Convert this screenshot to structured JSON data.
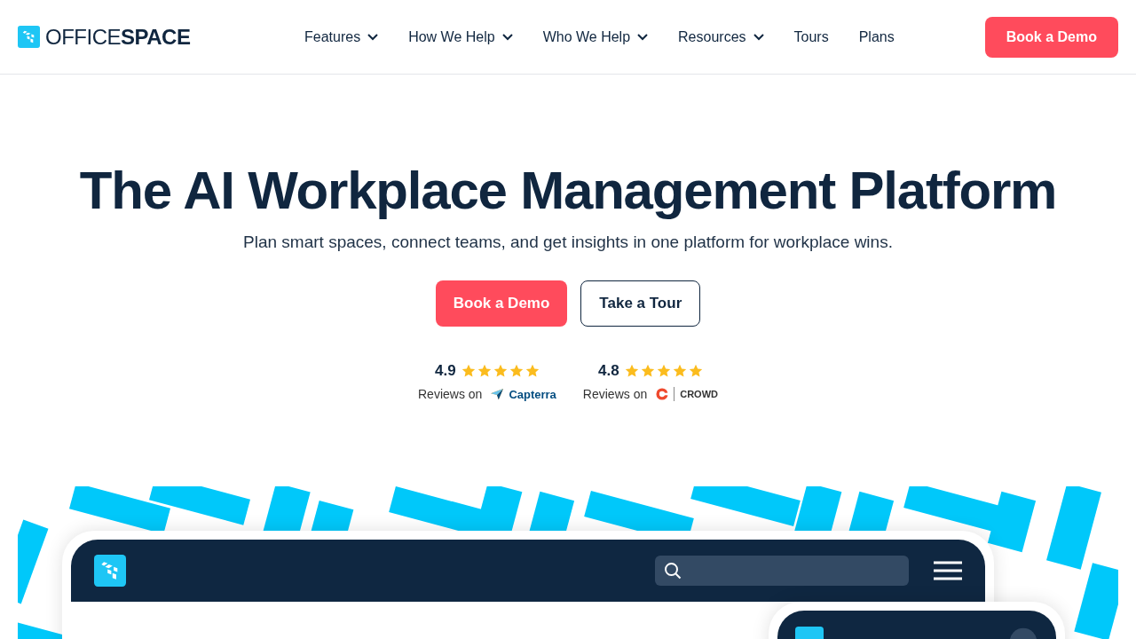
{
  "header": {
    "logo": "OFFICE**SPACE**",
    "nav": [
      {
        "label": "Features",
        "dropdown": true
      },
      {
        "label": "How We Help",
        "dropdown": true
      },
      {
        "label": "Who We Help",
        "dropdown": true
      },
      {
        "label": "Resources",
        "dropdown": true
      },
      {
        "label": "Tours",
        "dropdown": false
      },
      {
        "label": "Plans",
        "dropdown": false
      }
    ],
    "cta": "Book a Demo"
  },
  "hero": {
    "title": "The AI Workplace Management Platform",
    "subtitle": "Plan smart spaces, connect teams, and get insights in one platform for workplace wins.",
    "buttons": [
      {
        "label": "Book a Demo",
        "kind": "primary"
      },
      {
        "label": "Take a Tour",
        "kind": "secondary"
      }
    ],
    "ratings": [
      {
        "score": "4.9",
        "stars": 5,
        "caption": "Reviews on",
        "source": "Capterra",
        "kind": "capterra"
      },
      {
        "score": "4.8",
        "stars": 5,
        "caption": "Reviews on",
        "source": "CROWD",
        "kind": "g2"
      }
    ]
  }
}
